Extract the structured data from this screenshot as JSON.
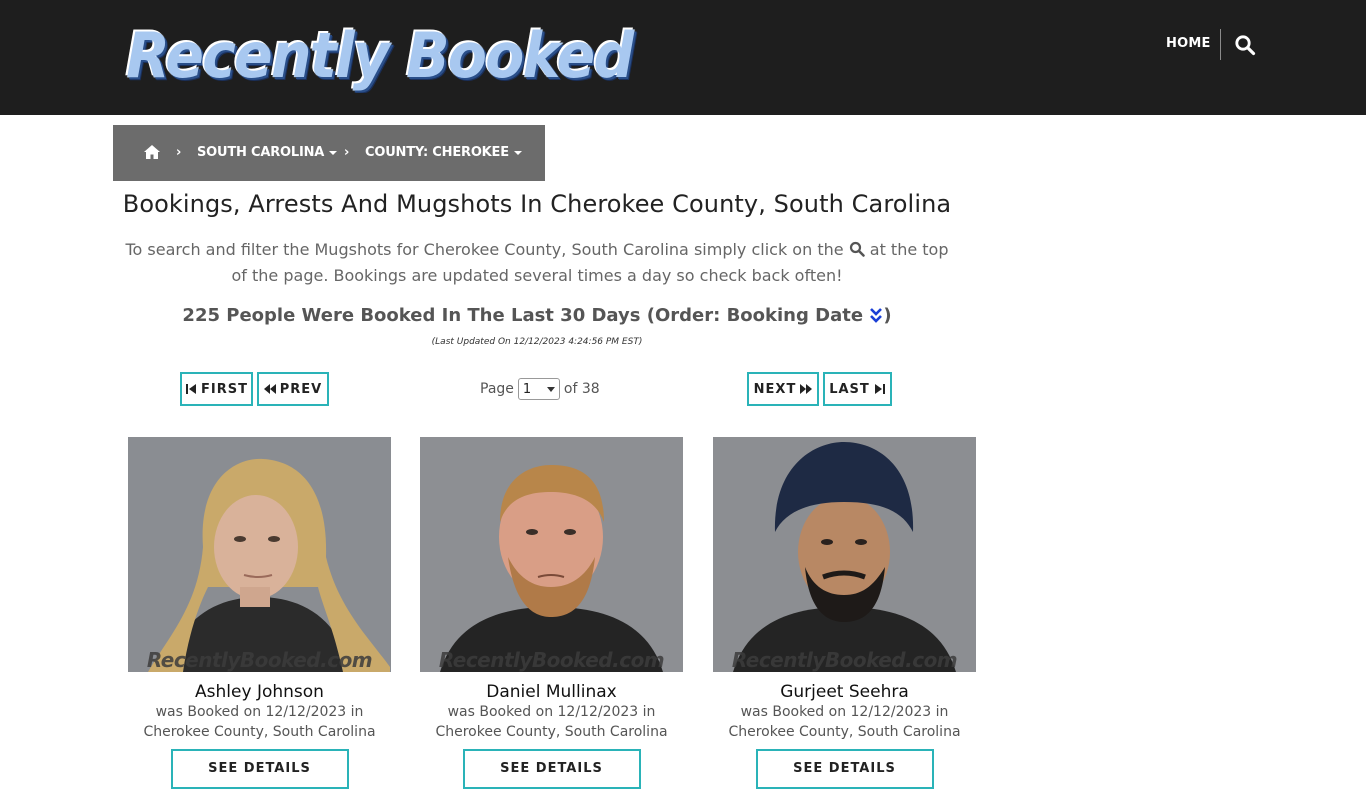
{
  "header": {
    "logo_text": "Recently Booked",
    "nav_home": "HOME",
    "search_icon": "search-icon"
  },
  "breadcrumb": {
    "home_icon": "home-icon",
    "items": [
      {
        "label": "SOUTH CAROLINA"
      },
      {
        "label": "COUNTY: CHEROKEE"
      }
    ]
  },
  "main": {
    "title": "Bookings, Arrests And Mugshots In Cherokee County, South Carolina",
    "intro_part1": "To search and filter the Mugshots for Cherokee County, South Carolina simply click on the",
    "intro_part2": "at the top of the page. Bookings are updated several times a day so check back often!",
    "count_text": "225 People Were Booked In The Last 30 Days (Order: Booking Date",
    "count_close": ")",
    "updated": "(Last Updated On 12/12/2023 4:24:56 PM EST)"
  },
  "pagination": {
    "first": "FIRST",
    "prev": "PREV",
    "next": "NEXT",
    "last": "LAST",
    "page_label": "Page",
    "page_value": "1",
    "of_label": "of 38"
  },
  "cards": [
    {
      "name": "Ashley Johnson",
      "booked_line": "was Booked on 12/12/2023 in",
      "location": "Cherokee County, South Carolina",
      "watermark": "RecentlyBooked.com",
      "button": "SEE DETAILS"
    },
    {
      "name": "Daniel Mullinax",
      "booked_line": "was Booked on 12/12/2023 in",
      "location": "Cherokee County, South Carolina",
      "watermark": "RecentlyBooked.com",
      "button": "SEE DETAILS"
    },
    {
      "name": "Gurjeet Seehra",
      "booked_line": "was Booked on 12/12/2023 in",
      "location": "Cherokee County, South Carolina",
      "watermark": "RecentlyBooked.com",
      "button": "SEE DETAILS"
    }
  ],
  "colors": {
    "header_bg": "#1e1e1e",
    "breadcrumb_bg": "#6c6c6c",
    "accent": "#2ab3b8"
  }
}
